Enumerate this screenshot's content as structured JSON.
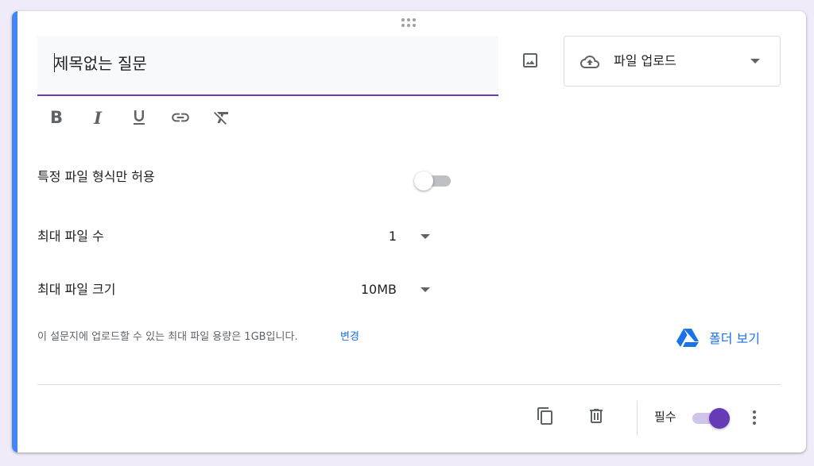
{
  "question": {
    "title_value": "",
    "title_placeholder": "제목없는 질문",
    "type_label": "파일 업로드",
    "type_icon": "cloud-upload-icon"
  },
  "format_toolbar": {
    "bold_label": "B",
    "italic_label": "I"
  },
  "settings": {
    "specific_types_label": "특정 파일 형식만 허용",
    "specific_types_enabled": false,
    "max_files_label": "최대 파일 수",
    "max_files_value": "1",
    "max_size_label": "최대 파일 크기",
    "max_size_value": "10MB"
  },
  "info": {
    "text": "이 설문지에 업로드할 수 있는 최대 파일 용량은 1GB입니다.",
    "change_link": "변경",
    "folder_link": "폴더 보기"
  },
  "footer": {
    "required_label": "필수",
    "required_enabled": true
  },
  "colors": {
    "accent": "#673ab7",
    "card_left_bar": "#4285f4",
    "link": "#1a73e8",
    "background": "#f0ebf8"
  }
}
